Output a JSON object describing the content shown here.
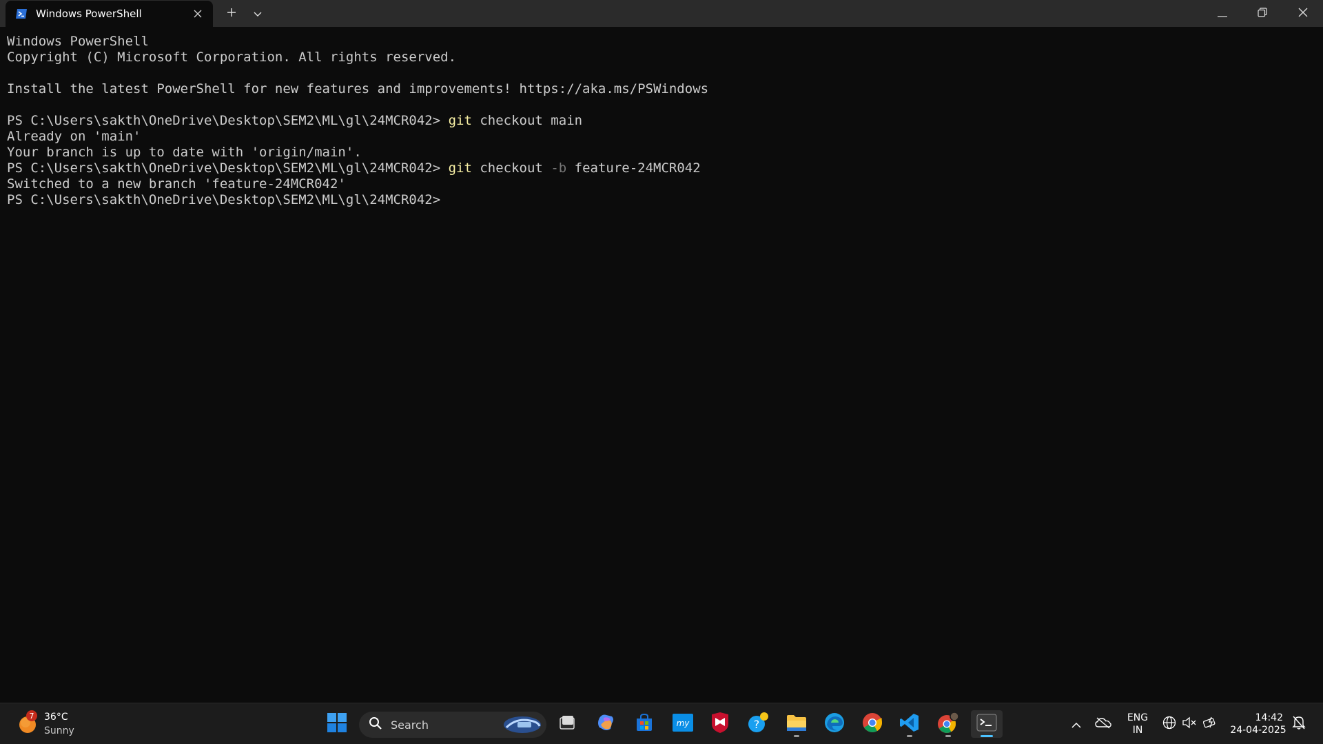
{
  "window": {
    "tab_title": "Windows PowerShell",
    "tab_icon": "powershell-icon",
    "new_tab_icon": "plus-icon",
    "dropdown_icon": "chevron-down-icon",
    "minimize_icon": "minimize-icon",
    "restore_icon": "restore-icon",
    "close_icon": "close-icon"
  },
  "terminal": {
    "lines": [
      {
        "text": "Windows PowerShell"
      },
      {
        "text": "Copyright (C) Microsoft Corporation. All rights reserved."
      },
      {
        "text": ""
      },
      {
        "text": "Install the latest PowerShell for new features and improvements! https://aka.ms/PSWindows"
      },
      {
        "text": ""
      },
      {
        "prompt": "PS C:\\Users\\sakth\\OneDrive\\Desktop\\SEM2\\ML\\gl\\24MCR042> ",
        "cmd": "git",
        "args": " checkout main"
      },
      {
        "text": "Already on 'main'"
      },
      {
        "text": "Your branch is up to date with 'origin/main'."
      },
      {
        "prompt": "PS C:\\Users\\sakth\\OneDrive\\Desktop\\SEM2\\ML\\gl\\24MCR042> ",
        "cmd": "git",
        "args": " checkout ",
        "flag": "-b",
        "args2": " feature-24MCR042"
      },
      {
        "text": "Switched to a new branch 'feature-24MCR042'"
      },
      {
        "prompt": "PS C:\\Users\\sakth\\OneDrive\\Desktop\\SEM2\\ML\\gl\\24MCR042> "
      }
    ],
    "colors": {
      "foreground": "#cccccc",
      "command": "#f9f1a5",
      "parameter": "#767676",
      "background": "#0c0c0c"
    }
  },
  "taskbar": {
    "weather": {
      "badge": "7",
      "temp": "36°C",
      "condition": "Sunny",
      "icon": "sun-icon"
    },
    "start_icon": "windows-start-icon",
    "search": {
      "placeholder": "Search",
      "icon": "search-icon"
    },
    "apps": [
      {
        "name": "task-view-icon"
      },
      {
        "name": "copilot-icon"
      },
      {
        "name": "microsoft-store-icon"
      },
      {
        "name": "myhp-icon"
      },
      {
        "name": "mcafee-icon"
      },
      {
        "name": "help-icon"
      },
      {
        "name": "file-explorer-icon"
      },
      {
        "name": "edge-icon"
      },
      {
        "name": "chrome-icon"
      },
      {
        "name": "vscode-icon"
      },
      {
        "name": "chrome-profile-icon"
      },
      {
        "name": "terminal-icon"
      }
    ],
    "tray": {
      "overflow_icon": "chevron-up-icon",
      "onedrive_icon": "onedrive-icon",
      "lang_line1": "ENG",
      "lang_line2": "IN",
      "network_icon": "globe-icon",
      "volume_icon": "mute-icon",
      "battery_icon": "battery-icon",
      "time": "14:42",
      "date": "24-04-2025",
      "notification_icon": "notification-bell-icon"
    }
  }
}
